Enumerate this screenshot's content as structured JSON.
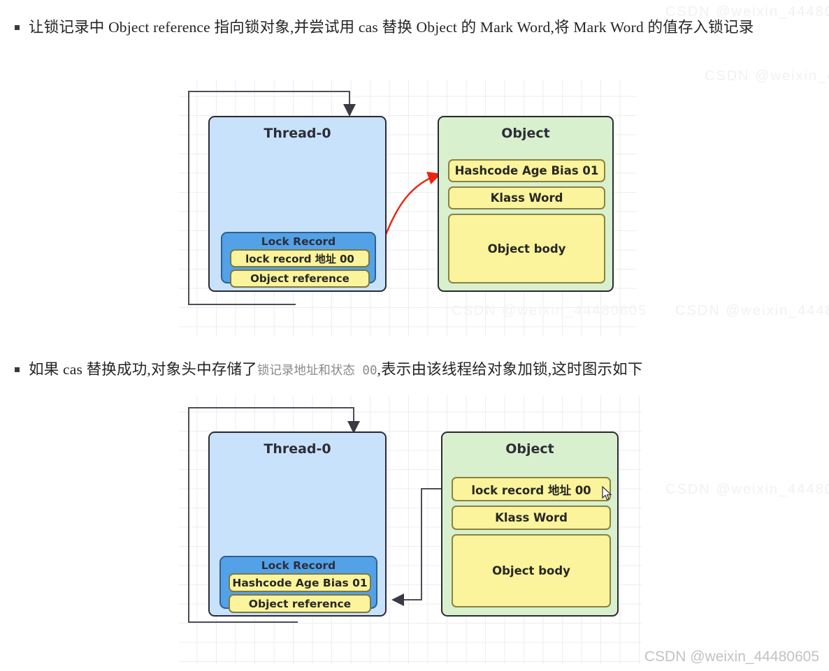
{
  "bullets": [
    {
      "marker": "square-bullet",
      "text_before": "让锁记录中 Object reference 指向锁对象,并尝试用 cas 替换 Object 的 Mark Word,将 Mark Word 的值存入锁记录"
    },
    {
      "marker": "square-bullet",
      "part1": "如果 cas 替换成功,对象头中存储了",
      "code": "锁记录地址和状态 00",
      "part2": ",表示由该线程给对象加锁,这时图示如下"
    }
  ],
  "diagram1": {
    "thread": {
      "title": "Thread-0",
      "lock_record": {
        "title": "Lock Record",
        "slots": [
          {
            "label": "lock record 地址 00"
          },
          {
            "label": "Object reference"
          }
        ]
      }
    },
    "object": {
      "title": "Object",
      "slots": [
        {
          "label": "Hashcode Age Bias 01"
        },
        {
          "label": "Klass Word"
        },
        {
          "label": "Object body"
        }
      ]
    },
    "arrows": {
      "object_reference_to_object": "elbow-arrow-up-right-down",
      "cas_swap": "red-double-headed-curve"
    }
  },
  "diagram2": {
    "thread": {
      "title": "Thread-0",
      "lock_record": {
        "title": "Lock Record",
        "slots": [
          {
            "label": "Hashcode Age Bias 01"
          },
          {
            "label": "Object reference"
          }
        ]
      }
    },
    "object": {
      "title": "Object",
      "slots": [
        {
          "label": "lock record 地址 00"
        },
        {
          "label": "Klass Word"
        },
        {
          "label": "Object body"
        }
      ]
    },
    "arrows": {
      "object_reference_to_object": "elbow-arrow-up-right-down",
      "markword_to_lock_record": "elbow-arrow-left-down-left"
    },
    "cursor": "mouse-pointer"
  },
  "watermarks": {
    "main": "CSDN @weixin_44480605",
    "faint": "CSDN @weixin_44480605"
  },
  "colors": {
    "thread_box": "#c9e2fb",
    "object_box": "#d9f0ce",
    "lock_record_box": "#53a2e8",
    "slot": "#fbf49c",
    "border": "#2b2b33",
    "red_arrow": "#ee2211",
    "connector": "#4d4d57",
    "grid": "#ededed"
  }
}
